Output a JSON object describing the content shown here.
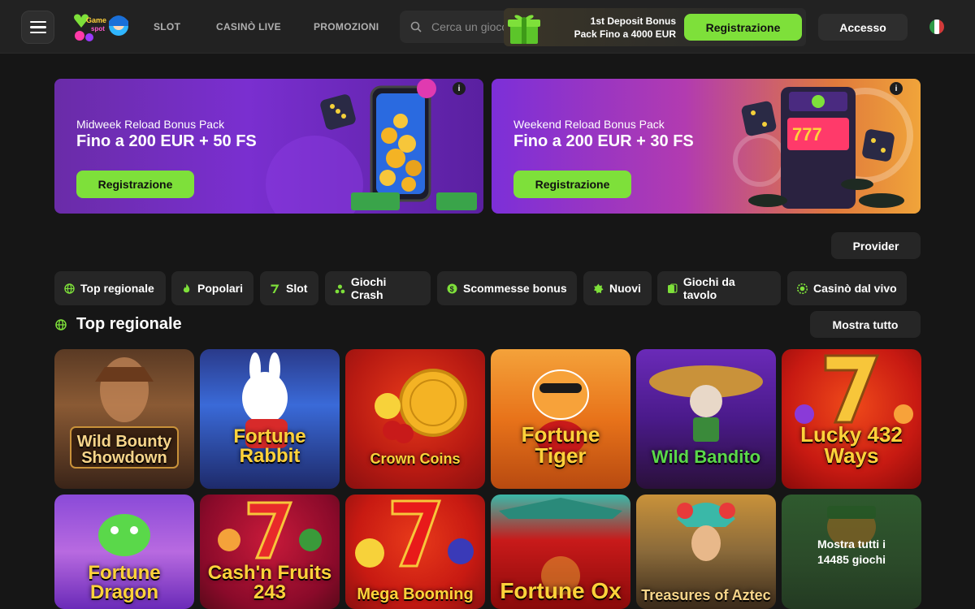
{
  "header": {
    "logo_alt": "GameSpot",
    "nav": [
      {
        "label": "SLOT"
      },
      {
        "label": "CASINÒ LIVE"
      },
      {
        "label": "PROMOZIONI"
      }
    ],
    "search_placeholder": "Cerca un gioco",
    "deposit_line1": "1st Deposit Bonus",
    "deposit_line2": "Pack Fino a 4000 EUR",
    "register_label": "Registrazione",
    "login_label": "Accesso"
  },
  "promos": [
    {
      "subtitle": "Midweek Reload Bonus Pack",
      "headline": "Fino a 200 EUR + 50 FS",
      "button": "Registrazione",
      "info": "i"
    },
    {
      "subtitle": "Weekend Reload Bonus Pack",
      "headline": "Fino a 200 EUR + 30 FS",
      "button": "Registrazione",
      "info": "i"
    }
  ],
  "provider_label": "Provider",
  "categories": [
    {
      "label": "Top regionale",
      "icon": "globe-icon"
    },
    {
      "label": "Popolari",
      "icon": "flame-icon"
    },
    {
      "label": "Slot",
      "icon": "seven-icon"
    },
    {
      "label": "Giochi Crash",
      "icon": "rocket-icon"
    },
    {
      "label": "Scommesse bonus",
      "icon": "coin-icon"
    },
    {
      "label": "Nuovi",
      "icon": "star-badge-icon"
    },
    {
      "label": "Giochi da tavolo",
      "icon": "cards-icon"
    },
    {
      "label": "Casinò dal vivo",
      "icon": "chip-icon"
    }
  ],
  "section": {
    "title": "Top regionale",
    "show_all": "Mostra tutto"
  },
  "games_row1": [
    {
      "name": "Wild Bounty Showdown"
    },
    {
      "name": "Fortune Rabbit"
    },
    {
      "name": "Crown Coins"
    },
    {
      "name": "Fortune Tiger"
    },
    {
      "name": "Wild Bandito"
    },
    {
      "name": "Lucky 432 Ways"
    }
  ],
  "games_row2": [
    {
      "name": "Fortune Dragon"
    },
    {
      "name": "Cash'n Fruits 243"
    },
    {
      "name": "Mega Booming"
    },
    {
      "name": "Fortune Ox"
    },
    {
      "name": "Treasures of Aztec"
    }
  ],
  "more_games": {
    "line1": "Mostra tutti i",
    "line2": "14485 giochi"
  },
  "colors": {
    "accent_green": "#7ee03a",
    "background": "#161616",
    "header": "#222222",
    "chip": "#262626"
  }
}
